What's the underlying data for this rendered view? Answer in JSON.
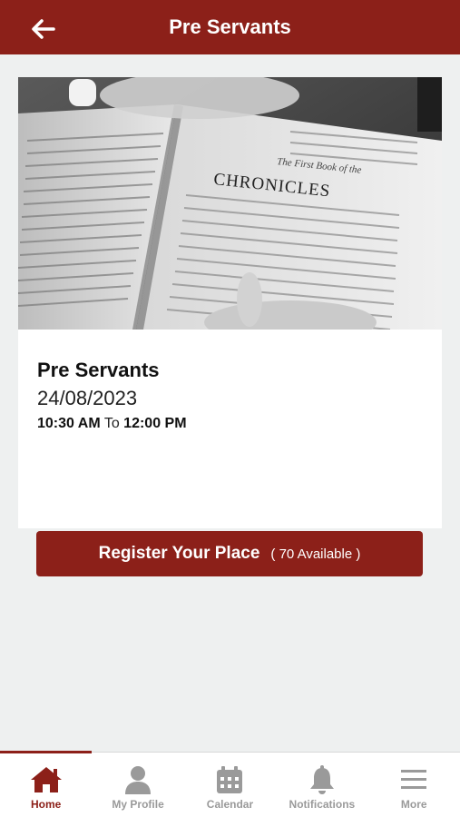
{
  "header": {
    "title": "Pre Servants",
    "back_icon": "arrow-left-icon"
  },
  "event": {
    "image_alt": "Open bible showing Chronicles",
    "image_text": {
      "book_heading": "The First Book of the",
      "book_title": "CHRONICLES"
    },
    "title": "Pre Servants",
    "date": "24/08/2023",
    "start_time": "10:30 AM",
    "time_separator": "To",
    "end_time": "12:00 PM",
    "register_label": "Register Your Place",
    "availability": "( 70 Available )"
  },
  "colors": {
    "brand": "#8c2019",
    "background": "#eef0f0",
    "inactive": "#9a9a9a"
  },
  "bottom_nav": {
    "items": [
      {
        "label": "Home",
        "icon": "home-icon",
        "active": true
      },
      {
        "label": "My Profile",
        "icon": "user-icon",
        "active": false
      },
      {
        "label": "Calendar",
        "icon": "calendar-icon",
        "active": false
      },
      {
        "label": "Notifications",
        "icon": "bell-icon",
        "active": false
      },
      {
        "label": "More",
        "icon": "menu-icon",
        "active": false
      }
    ]
  }
}
